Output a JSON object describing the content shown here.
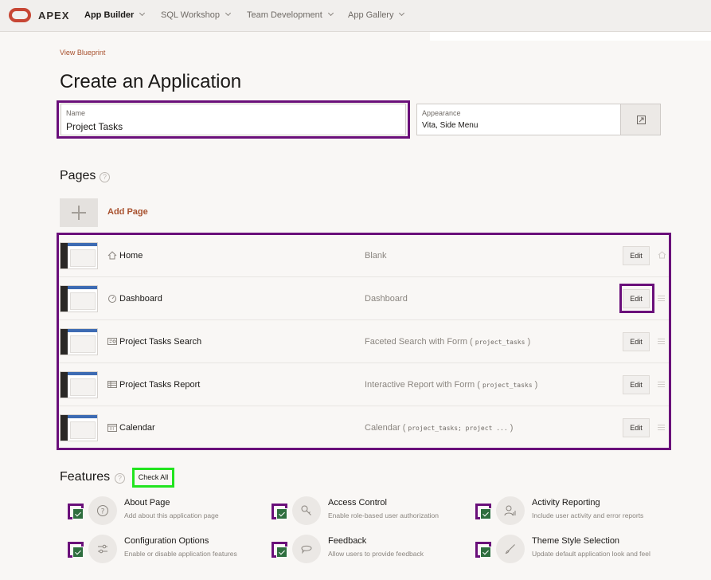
{
  "nav": {
    "brand": "APEX",
    "items": [
      {
        "label": "App Builder"
      },
      {
        "label": "SQL Workshop"
      },
      {
        "label": "Team Development"
      },
      {
        "label": "App Gallery"
      }
    ]
  },
  "breadcrumb": "View Blueprint",
  "title": "Create an Application",
  "name_field": {
    "label": "Name",
    "value": "Project Tasks"
  },
  "appearance_field": {
    "label": "Appearance",
    "value": "Vita, Side Menu"
  },
  "pages_section": {
    "title": "Pages",
    "help": "?",
    "add_label": "Add Page"
  },
  "pages": [
    {
      "name": "Home",
      "type": "Blank",
      "source": "",
      "edit": "Edit",
      "icon": "home-icon"
    },
    {
      "name": "Dashboard",
      "type": "Dashboard",
      "source": "",
      "edit": "Edit",
      "icon": "gauge-icon"
    },
    {
      "name": "Project Tasks Search",
      "type": "Faceted Search with Form (",
      "source": "project_tasks",
      "close": ")",
      "edit": "Edit",
      "icon": "search-form-icon"
    },
    {
      "name": "Project Tasks Report",
      "type": "Interactive Report with Form (",
      "source": "project_tasks",
      "close": ")",
      "edit": "Edit",
      "icon": "report-icon"
    },
    {
      "name": "Calendar",
      "type": "Calendar (",
      "source": "project_tasks; project ...",
      "close": ")",
      "edit": "Edit",
      "icon": "calendar-icon"
    }
  ],
  "features_section": {
    "title": "Features",
    "help": "?",
    "check_all": "Check All"
  },
  "features": [
    {
      "title": "About Page",
      "desc": "Add about this application page",
      "icon": "question-icon",
      "checked": true
    },
    {
      "title": "Access Control",
      "desc": "Enable role-based user authorization",
      "icon": "key-icon",
      "checked": true
    },
    {
      "title": "Activity Reporting",
      "desc": "Include user activity and error reports",
      "icon": "user-chart-icon",
      "checked": true
    },
    {
      "title": "Configuration Options",
      "desc": "Enable or disable application features",
      "icon": "sliders-icon",
      "checked": true
    },
    {
      "title": "Feedback",
      "desc": "Allow users to provide feedback",
      "icon": "chat-icon",
      "checked": true
    },
    {
      "title": "Theme Style Selection",
      "desc": "Update default application look and feel",
      "icon": "brush-icon",
      "checked": true
    }
  ],
  "colors": {
    "accent": "#a8512e",
    "brand_red": "#c74634",
    "highlight_purple": "#6a0f7a",
    "highlight_green": "#22e41f"
  }
}
